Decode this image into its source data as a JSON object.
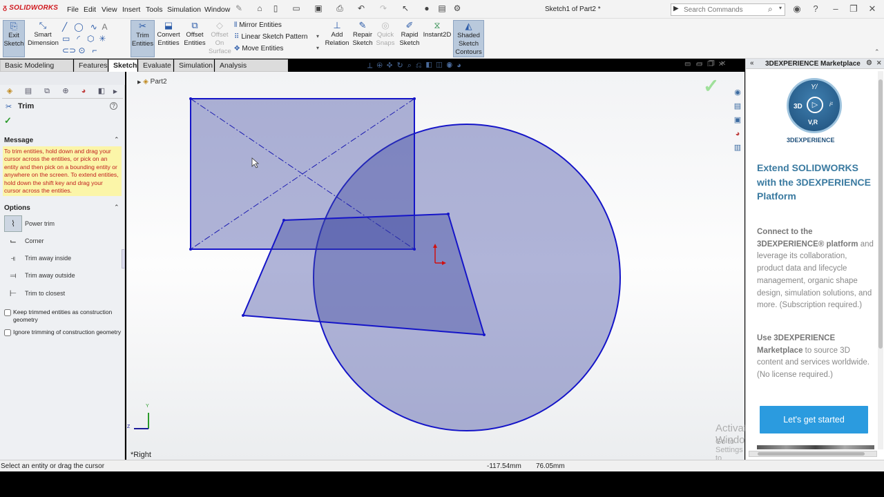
{
  "app": {
    "brand": "SOLIDWORKS",
    "document_title": "Sketch1 of Part2 *"
  },
  "menu": [
    "File",
    "Edit",
    "View",
    "Insert",
    "Tools",
    "Simulation",
    "Window"
  ],
  "search": {
    "placeholder": "Search Commands"
  },
  "ribbon": {
    "exit_sketch": [
      "Exit",
      "Sketch"
    ],
    "smart_dimension": [
      "Smart",
      "Dimension"
    ],
    "trim_entities": [
      "Trim",
      "Entities"
    ],
    "convert_entities": [
      "Convert",
      "Entities"
    ],
    "offset_entities": [
      "Offset",
      "Entities"
    ],
    "offset_on_surface": [
      "Offset",
      "On",
      "Surface"
    ],
    "mirror_entities": "Mirror Entities",
    "linear_sketch_pattern": "Linear Sketch Pattern",
    "move_entities": "Move Entities",
    "add_relation": [
      "Add",
      "Relation"
    ],
    "repair_sketch": [
      "Repair",
      "Sketch"
    ],
    "quick_snaps": [
      "Quick",
      "Snaps"
    ],
    "rapid_sketch": [
      "Rapid",
      "Sketch"
    ],
    "instant2d": "Instant2D",
    "shaded_sketch_contours": [
      "Shaded",
      "Sketch",
      "Contours"
    ]
  },
  "tabs": [
    {
      "label": "Basic Modeling Tools",
      "active": false
    },
    {
      "label": "Features",
      "active": false
    },
    {
      "label": "Sketch",
      "active": true
    },
    {
      "label": "Evaluate",
      "active": false
    },
    {
      "label": "Simulation",
      "active": false
    },
    {
      "label": "Analysis Preparation",
      "active": false
    }
  ],
  "property_manager": {
    "title": "Trim",
    "message_header": "Message",
    "message": "To trim entities, hold down and drag your cursor across the entities, or pick on an entity and then pick on a bounding entity or anywhere on the screen.  To extend entities, hold down the shift key and drag your cursor across the entities.",
    "options_header": "Options",
    "options": [
      {
        "label": "Power trim",
        "selected": true,
        "icon": "power-trim-icon"
      },
      {
        "label": "Corner",
        "selected": false,
        "icon": "corner-icon"
      },
      {
        "label": "Trim away inside",
        "selected": false,
        "icon": "trim-inside-icon"
      },
      {
        "label": "Trim away outside",
        "selected": false,
        "icon": "trim-outside-icon"
      },
      {
        "label": "Trim to closest",
        "selected": false,
        "icon": "trim-closest-icon"
      }
    ],
    "keep_trimmed": "Keep trimmed entities as construction geometry",
    "ignore_construction": "Ignore trimming of construction geometry"
  },
  "feature_tree": {
    "root": "Part2"
  },
  "viewport": {
    "view_label": "*Right",
    "triad_y": "Y",
    "triad_z": "Z",
    "sketch_color": "#1010c0",
    "fill_color": "#8a8fc4"
  },
  "marketplace": {
    "header": "3DEXPERIENCE Marketplace",
    "logo_caption": "3DEXPERIENCE",
    "logo_3d": "3D",
    "logo_vr": "V,R",
    "logo_top": "Y/",
    "logo_i": "i¹",
    "title": "Extend SOLIDWORKS with the 3DEXPERIENCE Platform",
    "para1_bold": "Connect to the 3DEXPERIENCE® platform",
    "para1_rest": " and leverage its collaboration, product data and lifecycle management, organic shape design, simulation solutions, and more. (Subscription required.)",
    "para2_bold": "Use 3DEXPERIENCE Marketplace",
    "para2_rest": " to source 3D content and services worldwide. (No license required.)",
    "cta": "Let's get started"
  },
  "watermark": {
    "line1": "Activate Windows",
    "line2": "Go to Settings to activate Windows."
  },
  "status": {
    "hint": "Select an entity or drag the cursor",
    "x": "-117.54mm",
    "y": "76.05mm"
  }
}
